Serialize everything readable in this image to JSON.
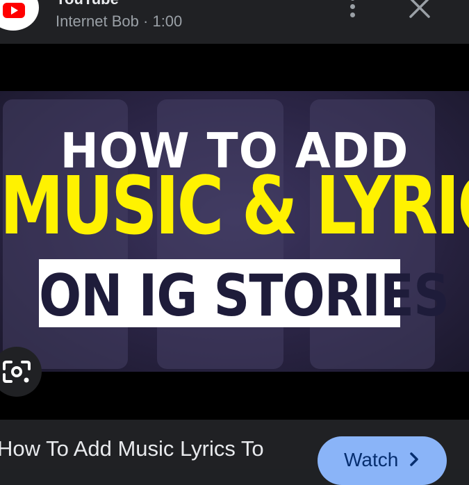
{
  "header": {
    "source_name": "YouTube",
    "channel": "Internet Bob",
    "separator": "·",
    "duration": "1:00",
    "more_icon": "more-vert-icon",
    "close_icon": "close-icon"
  },
  "thumbnail": {
    "line1": "HOW TO ADD",
    "line2": "MUSIC & LYRICS",
    "line3": "ON IG STORIES",
    "colors": {
      "line1": "#ffffff",
      "line2": "#fff200",
      "line3": "#1e1c3a",
      "box": "#ffffff"
    }
  },
  "lens_icon": "google-lens-icon",
  "footer": {
    "caption": "How To Add Music Lyrics To",
    "watch_label": "Watch",
    "watch_icon": "chevron-right-icon",
    "accent": "#8ab4f8"
  }
}
